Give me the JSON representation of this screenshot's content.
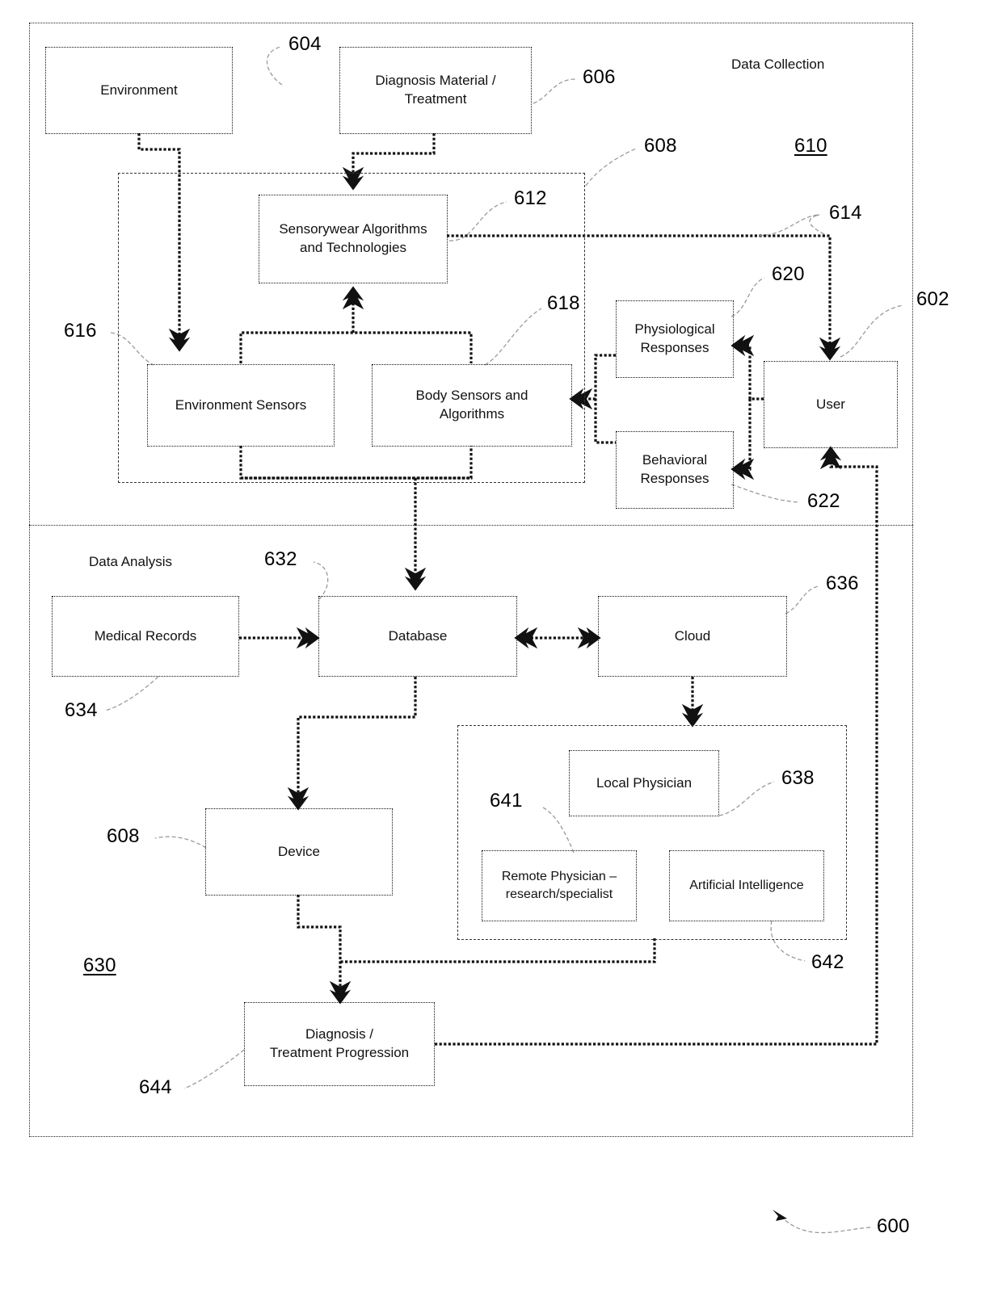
{
  "figure": {
    "number": "600",
    "sections": [
      {
        "id": "data-collection",
        "caption": "Data Collection",
        "ref": "610"
      },
      {
        "id": "data-analysis",
        "caption": "Data Analysis",
        "ref": "630"
      }
    ]
  },
  "nodes": {
    "environment": {
      "label": "Environment",
      "ref": "604"
    },
    "diagnosis_material": {
      "label_line1": "Diagnosis Material /",
      "label_line2": "Treatment",
      "ref": "606"
    },
    "sensorywear": {
      "label_line1": "Sensorywear Algorithms",
      "label_line2": "and Technologies",
      "ref": "612"
    },
    "environment_sensors": {
      "label": "Environment Sensors",
      "ref": "616"
    },
    "body_sensors": {
      "label_line1": "Body Sensors and",
      "label_line2": "Algorithms",
      "ref": "618"
    },
    "physiological": {
      "label_line1": "Physiological",
      "label_line2": "Responses",
      "ref": "620"
    },
    "behavioral": {
      "label_line1": "Behavioral",
      "label_line2": "Responses",
      "ref": "622"
    },
    "user": {
      "label": "User",
      "ref": "602"
    },
    "medical_records": {
      "label": "Medical Records",
      "ref": "634"
    },
    "database": {
      "label": "Database",
      "ref": "632"
    },
    "cloud": {
      "label": "Cloud",
      "ref": "636"
    },
    "device": {
      "label": "Device",
      "ref": "608"
    },
    "local_physician": {
      "label": "Local Physician",
      "ref": "638"
    },
    "remote_physician": {
      "label_line1": "Remote Physician –",
      "label_line2": "research/specialist",
      "ref": "641"
    },
    "artificial_intelligence": {
      "label": "Artificial Intelligence",
      "ref": "642"
    },
    "diagnosis_progression": {
      "label_line1": "Diagnosis /",
      "label_line2": "Treatment Progression",
      "ref": "644"
    }
  },
  "groups": {
    "sensor_platform": {
      "ref": "608"
    },
    "physician_ai": {
      "ref": "642"
    }
  },
  "refs": {
    "r600": "600",
    "r602": "602",
    "r604": "604",
    "r606": "606",
    "r608_top": "608",
    "r608_device": "608",
    "r610": "610",
    "r612": "612",
    "r614": "614",
    "r616": "616",
    "r618": "618",
    "r620": "620",
    "r622": "622",
    "r630": "630",
    "r632": "632",
    "r634": "634",
    "r636": "636",
    "r638": "638",
    "r641": "641",
    "r642": "642",
    "r644": "644"
  },
  "colors": {
    "line": "#111111",
    "leader": "#9a9a9a",
    "background": "#ffffff"
  }
}
